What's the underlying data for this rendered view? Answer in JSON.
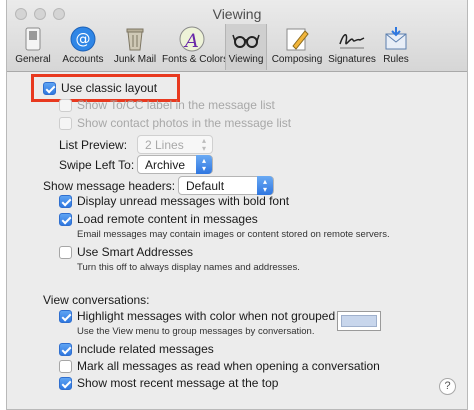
{
  "window": {
    "title": "Viewing"
  },
  "toolbar": [
    {
      "id": "general",
      "label": "General",
      "icon": "switch-icon"
    },
    {
      "id": "accounts",
      "label": "Accounts",
      "icon": "at-sign-icon"
    },
    {
      "id": "junk",
      "label": "Junk Mail",
      "icon": "trash-icon"
    },
    {
      "id": "fonts",
      "label": "Fonts & Colors",
      "icon": "font-icon"
    },
    {
      "id": "viewing",
      "label": "Viewing",
      "icon": "glasses-icon"
    },
    {
      "id": "composing",
      "label": "Composing",
      "icon": "pencil-icon"
    },
    {
      "id": "signatures",
      "label": "Signatures",
      "icon": "signature-icon"
    },
    {
      "id": "rules",
      "label": "Rules",
      "icon": "envelope-icon"
    }
  ],
  "options": {
    "classic_layout": "Use classic layout",
    "tocc_label": "Show To/CC label in the message list",
    "contact_photos": "Show contact photos in the message list",
    "list_preview_label": "List Preview:",
    "list_preview_value": "2 Lines",
    "swipe_left_label": "Swipe Left To:",
    "swipe_left_value": "Archive",
    "headers_label": "Show message headers:",
    "headers_value": "Default",
    "bold_unread": "Display unread messages with bold font",
    "load_remote": "Load remote content in messages",
    "load_remote_note": "Email messages may contain images or content stored on remote servers.",
    "smart_addresses": "Use Smart Addresses",
    "smart_addresses_note": "Turn this off to always display names and addresses."
  },
  "conversations": {
    "heading": "View conversations:",
    "highlight": "Highlight messages with color when not grouped",
    "highlight_note": "Use the View menu to group messages by conversation.",
    "include_related": "Include related messages",
    "mark_all_read": "Mark all messages as read when opening a conversation",
    "most_recent_top": "Show most recent message at the top"
  },
  "help": {
    "label": "?"
  },
  "colors": {
    "accent": "#2f78e0",
    "highlight_border": "#e8391f",
    "swatch": "#c8d6ec"
  }
}
